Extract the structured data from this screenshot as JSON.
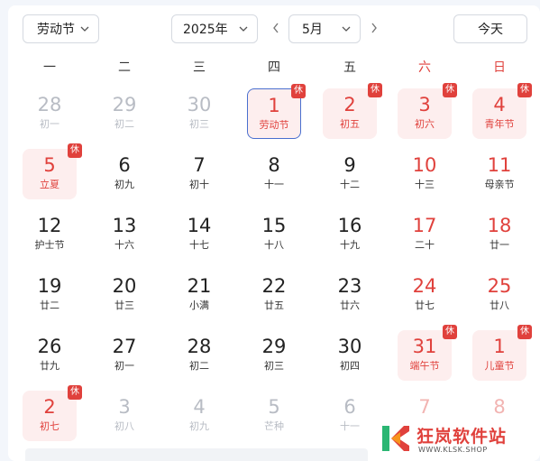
{
  "toolbar": {
    "holiday_select": "劳动节",
    "year_select": "2025年",
    "month_select": "5月",
    "today_button": "今天"
  },
  "weekdays": [
    "一",
    "二",
    "三",
    "四",
    "五",
    "六",
    "日"
  ],
  "colors": {
    "accent_red": "#e0413c",
    "selected_border": "#4a6fcf",
    "rest_bg": "#fdeeee"
  },
  "rest_badge": "休",
  "weeks": [
    [
      {
        "day": "28",
        "sub": "初一",
        "other": true
      },
      {
        "day": "29",
        "sub": "初二",
        "other": true
      },
      {
        "day": "30",
        "sub": "初三",
        "other": true
      },
      {
        "day": "1",
        "sub": "劳动节",
        "red": true,
        "rest": true,
        "badge": true,
        "selected": true
      },
      {
        "day": "2",
        "sub": "初五",
        "red": true,
        "rest": true,
        "badge": true
      },
      {
        "day": "3",
        "sub": "初六",
        "red": true,
        "rest": true,
        "badge": true
      },
      {
        "day": "4",
        "sub": "青年节",
        "red": true,
        "rest": true,
        "badge": true
      }
    ],
    [
      {
        "day": "5",
        "sub": "立夏",
        "red": true,
        "rest": true,
        "badge": true
      },
      {
        "day": "6",
        "sub": "初九"
      },
      {
        "day": "7",
        "sub": "初十"
      },
      {
        "day": "8",
        "sub": "十一"
      },
      {
        "day": "9",
        "sub": "十二"
      },
      {
        "day": "10",
        "sub": "十三",
        "weekend": true
      },
      {
        "day": "11",
        "sub": "母亲节",
        "weekend": true
      }
    ],
    [
      {
        "day": "12",
        "sub": "护士节"
      },
      {
        "day": "13",
        "sub": "十六"
      },
      {
        "day": "14",
        "sub": "十七"
      },
      {
        "day": "15",
        "sub": "十八"
      },
      {
        "day": "16",
        "sub": "十九"
      },
      {
        "day": "17",
        "sub": "二十",
        "weekend": true
      },
      {
        "day": "18",
        "sub": "廿一",
        "weekend": true
      }
    ],
    [
      {
        "day": "19",
        "sub": "廿二"
      },
      {
        "day": "20",
        "sub": "廿三"
      },
      {
        "day": "21",
        "sub": "小满"
      },
      {
        "day": "22",
        "sub": "廿五"
      },
      {
        "day": "23",
        "sub": "廿六"
      },
      {
        "day": "24",
        "sub": "廿七",
        "weekend": true
      },
      {
        "day": "25",
        "sub": "廿八",
        "weekend": true
      }
    ],
    [
      {
        "day": "26",
        "sub": "廿九"
      },
      {
        "day": "27",
        "sub": "初一"
      },
      {
        "day": "28",
        "sub": "初二"
      },
      {
        "day": "29",
        "sub": "初三"
      },
      {
        "day": "30",
        "sub": "初四"
      },
      {
        "day": "31",
        "sub": "端午节",
        "red": true,
        "rest": true,
        "badge": true
      },
      {
        "day": "1",
        "sub": "儿童节",
        "red": true,
        "rest": true,
        "badge": true
      }
    ],
    [
      {
        "day": "2",
        "sub": "初七",
        "red": true,
        "rest": true,
        "badge": true
      },
      {
        "day": "3",
        "sub": "初八",
        "other": true
      },
      {
        "day": "4",
        "sub": "初九",
        "other": true
      },
      {
        "day": "5",
        "sub": "芒种",
        "other": true
      },
      {
        "day": "6",
        "sub": "十一",
        "other": true
      },
      {
        "day": "7",
        "sub": "",
        "other": true,
        "weekend": true
      },
      {
        "day": "8",
        "sub": "",
        "other": true,
        "weekend": true
      }
    ]
  ],
  "watermark": {
    "title": "狂岚软件站",
    "url": "WWW.KLSK.SHOP"
  }
}
